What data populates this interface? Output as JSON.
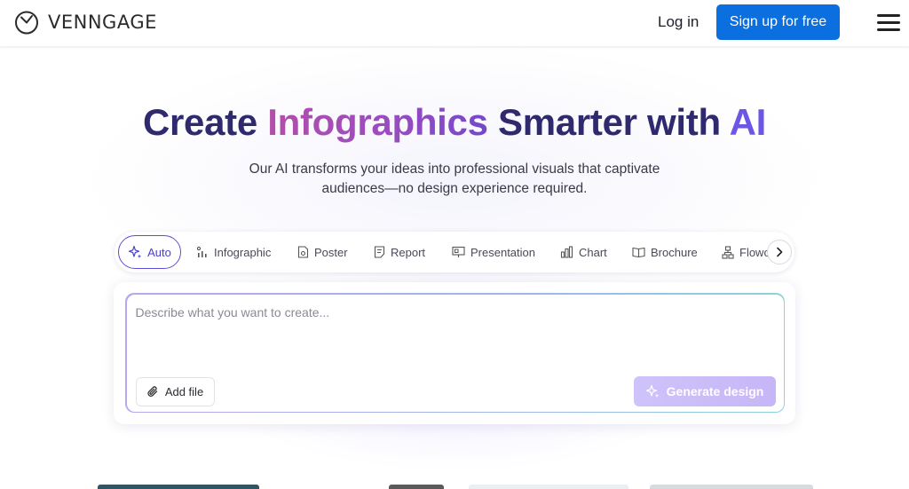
{
  "header": {
    "logo_text": "VENNGAGE",
    "login_label": "Log in",
    "signup_label": "Sign up for free"
  },
  "hero": {
    "headline_part1": "Create ",
    "headline_highlight": "Infographics",
    "headline_part2": " Smarter with ",
    "headline_ai": "AI",
    "subtitle": "Our AI transforms your ideas into professional visuals that captivate audiences—no design experience required."
  },
  "tabs": [
    {
      "label": "Auto",
      "icon": "sparkle-icon",
      "active": true
    },
    {
      "label": "Infographic",
      "icon": "infographic-icon"
    },
    {
      "label": "Poster",
      "icon": "poster-icon"
    },
    {
      "label": "Report",
      "icon": "report-icon"
    },
    {
      "label": "Presentation",
      "icon": "presentation-icon"
    },
    {
      "label": "Chart",
      "icon": "chart-icon"
    },
    {
      "label": "Brochure",
      "icon": "brochure-icon"
    },
    {
      "label": "Flowc",
      "icon": "flowchart-icon"
    }
  ],
  "prompt": {
    "placeholder": "Describe what you want to create...",
    "add_file_label": "Add file",
    "generate_label": "Generate design"
  },
  "colors": {
    "brand_blue": "#0b6fe0",
    "headline_navy": "#2f2a6e",
    "highlight_purple": "#9a4cc0",
    "accent_violet": "#6c56e6",
    "generate_disabled": "#c9baf8"
  }
}
